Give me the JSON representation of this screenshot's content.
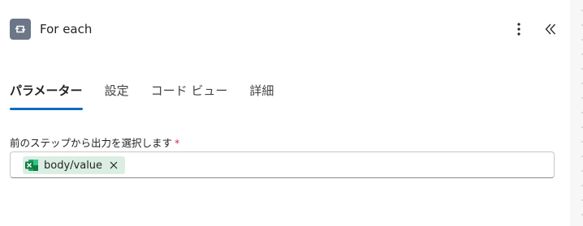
{
  "header": {
    "title": "For each",
    "action_icon": "loop-icon",
    "more_icon": "more-vertical-icon",
    "collapse_icon": "double-chevron-left-icon"
  },
  "tabs": [
    {
      "label": "パラメーター",
      "active": true
    },
    {
      "label": "設定",
      "active": false
    },
    {
      "label": "コード ビュー",
      "active": false
    },
    {
      "label": "詳細",
      "active": false
    }
  ],
  "field": {
    "label": "前のステップから出力を選択します",
    "required_mark": "*",
    "token": {
      "icon": "excel-icon",
      "text": "body/value",
      "remove_icon": "close-icon"
    }
  },
  "colors": {
    "accent": "#0f6cbd",
    "action_icon_bg": "#6b7787",
    "token_bg": "#dbeee3",
    "excel_green": "#107c41",
    "required": "#c4314b"
  }
}
